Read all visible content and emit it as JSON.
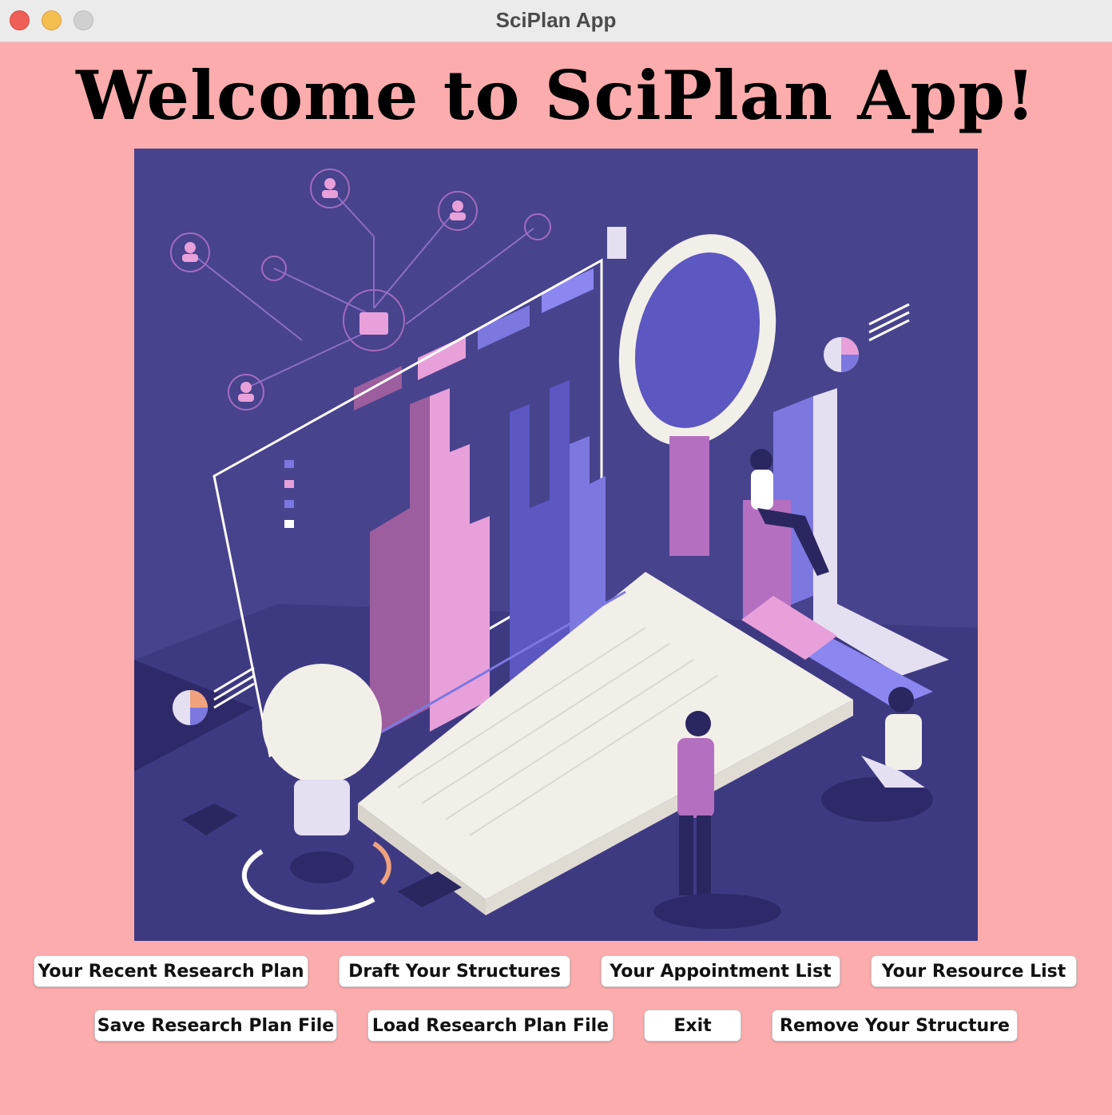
{
  "window": {
    "title": "SciPlan App"
  },
  "main": {
    "heading": "Welcome to SciPlan App!",
    "buttons_row1": [
      "Your Recent Research Plan",
      "Draft Your Structures",
      "Your Appointment List",
      "Your Resource List"
    ],
    "buttons_row2": [
      "Save Research Plan File",
      "Load Research Plan File",
      "Exit",
      "Remove Your Structure"
    ]
  },
  "colors": {
    "background": "#fdacad",
    "illustration_bg": "#47438d",
    "accent_purple": "#7d78e0",
    "accent_pink": "#e8a0da"
  }
}
